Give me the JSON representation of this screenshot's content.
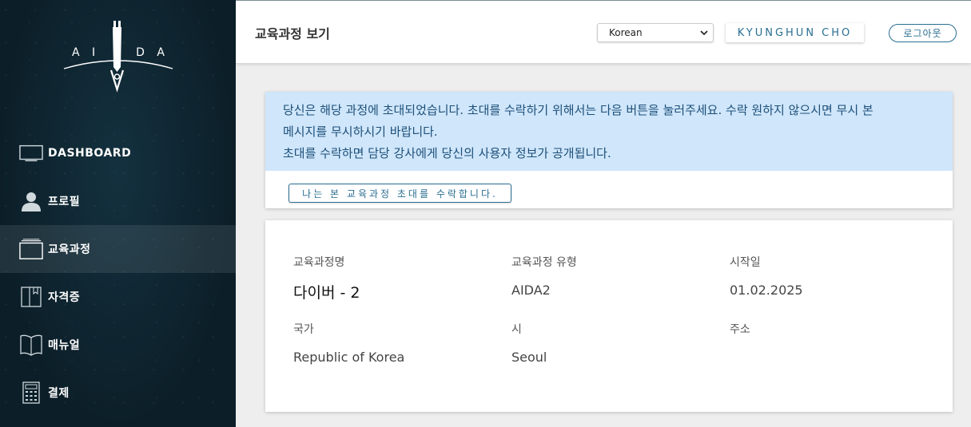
{
  "sidebar": {
    "logo_letters": [
      "A",
      "I",
      "D",
      "A"
    ],
    "items": [
      {
        "label": "DASHBOARD",
        "icon": "monitor-icon",
        "active": false
      },
      {
        "label": "프로필",
        "icon": "user-icon",
        "active": false
      },
      {
        "label": "교육과정",
        "icon": "folder-icon",
        "active": true
      },
      {
        "label": "자격증",
        "icon": "certificate-book-icon",
        "active": false
      },
      {
        "label": "매뉴얼",
        "icon": "open-book-icon",
        "active": false
      },
      {
        "label": "결제",
        "icon": "calculator-icon",
        "active": false
      }
    ]
  },
  "header": {
    "title": "교육과정 보기",
    "language_selected": "Korean",
    "user_name": "KYUNGHUN CHO",
    "logout_label": "로그아웃"
  },
  "invitation": {
    "line1": "당신은 해당 과정에 초대되었습니다. 초대를 수락하기 위해서는 다음 버튼을 눌러주세요. 수락 원하지 않으시면 무시 본",
    "line2": "메시지를 무시하시기 바랍니다.",
    "line3": "초대를 수락하면 담당 강사에게 당신의 사용자 정보가 공개됩니다.",
    "accept_label": "나는 본 교육과정 초대를 수락합니다."
  },
  "course": {
    "name_label": "교육과정명",
    "name_value": "다이버 - 2",
    "type_label": "교육과정 유형",
    "type_value": "AIDA2",
    "start_label": "시작일",
    "start_value": "01.02.2025",
    "country_label": "국가",
    "country_value": "Republic of Korea",
    "city_label": "시",
    "city_value": "Seoul",
    "address_label": "주소",
    "address_value": ""
  },
  "colors": {
    "sidebar_bg": "#0e2430",
    "accent": "#2a6e92",
    "invite_bg": "#cfe6fb"
  }
}
